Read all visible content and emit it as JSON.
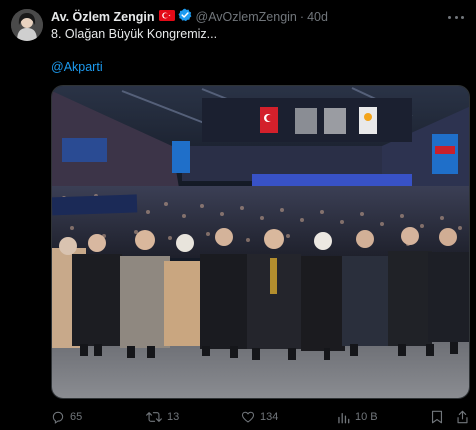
{
  "tweet": {
    "author_name": "Av. Özlem Zengin",
    "author_handle": "@AvOzlemZengin",
    "separator": "·",
    "time": "40d",
    "text": "8. Olağan Büyük Kongremiz...",
    "mention": "@Akparti",
    "flag_icon": "turkey-flag-icon",
    "verified_icon": "verified-badge-icon",
    "colors": {
      "background": "#000000",
      "text": "#e7e9ea",
      "muted": "#71767b",
      "link": "#1d9bf0",
      "verified": "#1d9bf0",
      "flag": "#e30a17"
    }
  },
  "actions": {
    "reply_count": "65",
    "retweet_count": "13",
    "like_count": "134",
    "views_count": "10 B"
  }
}
